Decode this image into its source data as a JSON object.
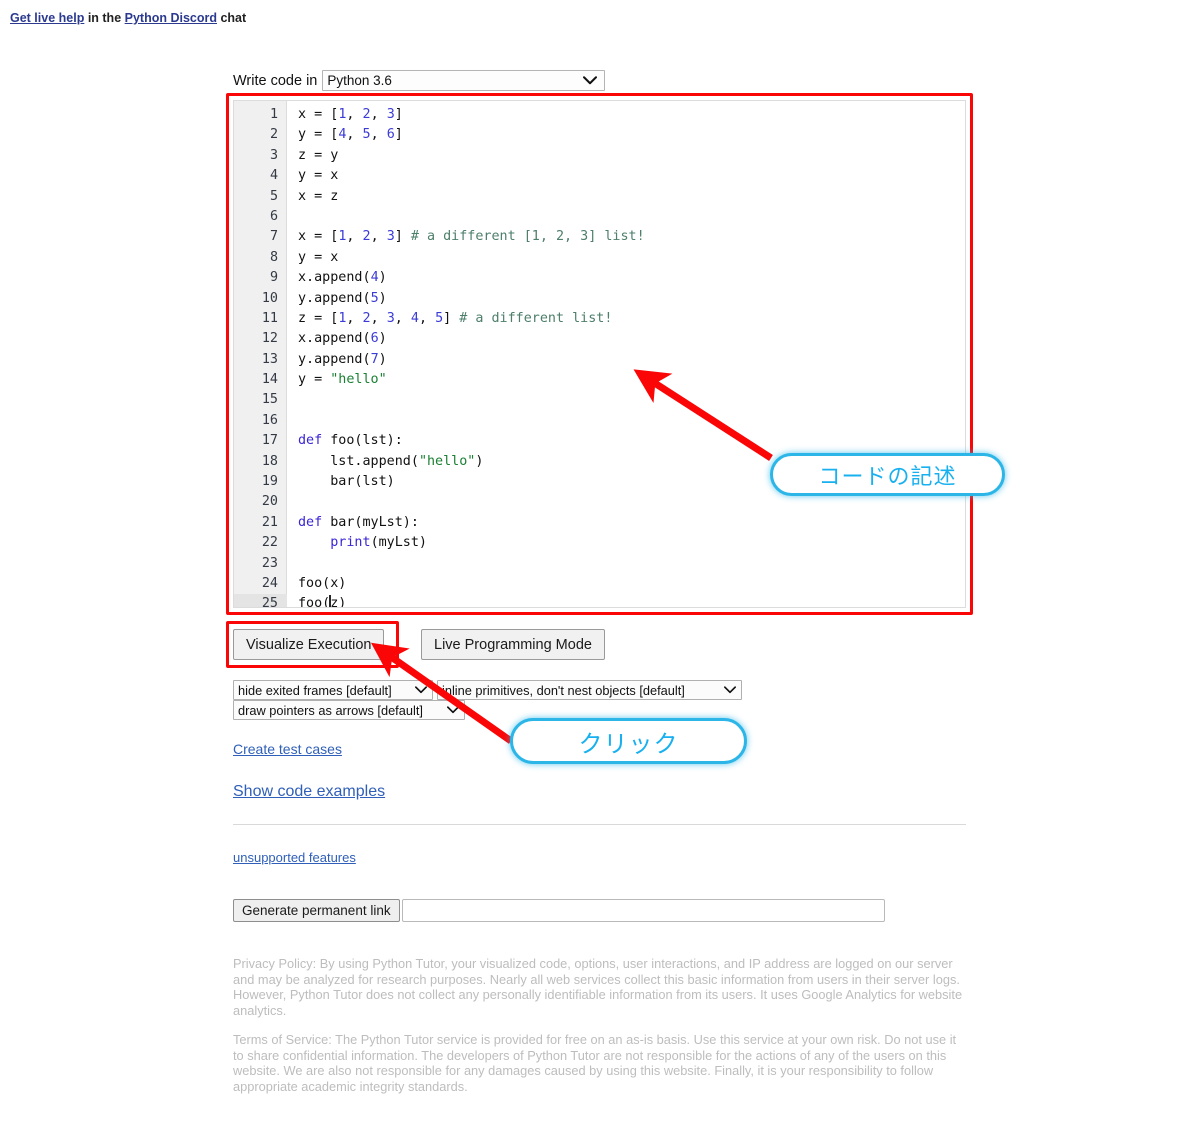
{
  "header": {
    "help_prefix": "Get live help",
    "help_mid": " in the ",
    "help_link2": "Python Discord",
    "help_suffix": " chat"
  },
  "language": {
    "label": "Write code in",
    "selected": "Python 3.6",
    "chevron": "chevron-down-icon"
  },
  "editor": {
    "active_line": 25,
    "lines": [
      {
        "n": "1",
        "html": "x = [<span class=\"tok-num\">1</span>, <span class=\"tok-num\">2</span>, <span class=\"tok-num\">3</span>]"
      },
      {
        "n": "2",
        "html": "y = [<span class=\"tok-num\">4</span>, <span class=\"tok-num\">5</span>, <span class=\"tok-num\">6</span>]"
      },
      {
        "n": "3",
        "html": "z = y"
      },
      {
        "n": "4",
        "html": "y = x"
      },
      {
        "n": "5",
        "html": "x = z"
      },
      {
        "n": "6",
        "html": ""
      },
      {
        "n": "7",
        "html": "x = [<span class=\"tok-num\">1</span>, <span class=\"tok-num\">2</span>, <span class=\"tok-num\">3</span>] <span class=\"tok-com\"># a different [1, 2, 3] list!</span>"
      },
      {
        "n": "8",
        "html": "y = x"
      },
      {
        "n": "9",
        "html": "x.append(<span class=\"tok-num\">4</span>)"
      },
      {
        "n": "10",
        "html": "y.append(<span class=\"tok-num\">5</span>)"
      },
      {
        "n": "11",
        "html": "z = [<span class=\"tok-num\">1</span>, <span class=\"tok-num\">2</span>, <span class=\"tok-num\">3</span>, <span class=\"tok-num\">4</span>, <span class=\"tok-num\">5</span>] <span class=\"tok-com\"># a different list!</span>"
      },
      {
        "n": "12",
        "html": "x.append(<span class=\"tok-num\">6</span>)"
      },
      {
        "n": "13",
        "html": "y.append(<span class=\"tok-num\">7</span>)"
      },
      {
        "n": "14",
        "html": "y = <span class=\"tok-str\">\"hello\"</span>"
      },
      {
        "n": "15",
        "html": ""
      },
      {
        "n": "16",
        "html": ""
      },
      {
        "n": "17",
        "html": "<span class=\"tok-kw\">def</span> foo(lst):"
      },
      {
        "n": "18",
        "html": "    lst.append(<span class=\"tok-str\">\"hello\"</span>)"
      },
      {
        "n": "19",
        "html": "    bar(lst)"
      },
      {
        "n": "20",
        "html": ""
      },
      {
        "n": "21",
        "html": "<span class=\"tok-kw\">def</span> bar(myLst):"
      },
      {
        "n": "22",
        "html": "    <span class=\"tok-bi\">print</span>(myLst)"
      },
      {
        "n": "23",
        "html": ""
      },
      {
        "n": "24",
        "html": "foo(x)"
      },
      {
        "n": "25",
        "html": "foo(<span class=\"caret\"></span>z)"
      }
    ],
    "plain_text": "x = [1, 2, 3]\ny = [4, 5, 6]\nz = y\ny = x\nx = z\n\nx = [1, 2, 3] # a different [1, 2, 3] list!\ny = x\nx.append(4)\ny.append(5)\nz = [1, 2, 3, 4, 5] # a different list!\nx.append(6)\ny.append(7)\ny = \"hello\"\n\n\ndef foo(lst):\n    lst.append(\"hello\")\n    bar(lst)\n\ndef bar(myLst):\n    print(myLst)\n\nfoo(x)\nfoo(z)"
  },
  "actions": {
    "visualize": "Visualize Execution",
    "live_mode": "Live Programming Mode"
  },
  "options": {
    "frames": "hide exited frames [default]",
    "inline": "inline primitives, don't nest objects [default]",
    "pointers": "draw pointers as arrows [default]"
  },
  "links": {
    "test_cases": "Create test cases",
    "code_examples": "Show code examples",
    "unsupported": "unsupported features"
  },
  "permalink": {
    "button": "Generate permanent link",
    "value": "",
    "placeholder": ""
  },
  "legal": {
    "privacy": "Privacy Policy: By using Python Tutor, your visualized code, options, user interactions, and IP address are logged on our server and may be analyzed for research purposes. Nearly all web services collect this basic information from users in their server logs. However, Python Tutor does not collect any personally identifiable information from its users. It uses Google Analytics for website analytics.",
    "terms": "Terms of Service: The Python Tutor service is provided for free on an as-is basis. Use this service at your own risk. Do not use it to share confidential information. The developers of Python Tutor are not responsible for the actions of any of the users on this website. We are also not responsible for any damages caused by using this website. Finally, it is your responsibility to follow appropriate academic integrity standards."
  },
  "annotations": {
    "bubble_code": "コードの記述",
    "bubble_click": "クリック",
    "highlight_color": "#fb0606",
    "bubble_color": "#19b0ef"
  }
}
